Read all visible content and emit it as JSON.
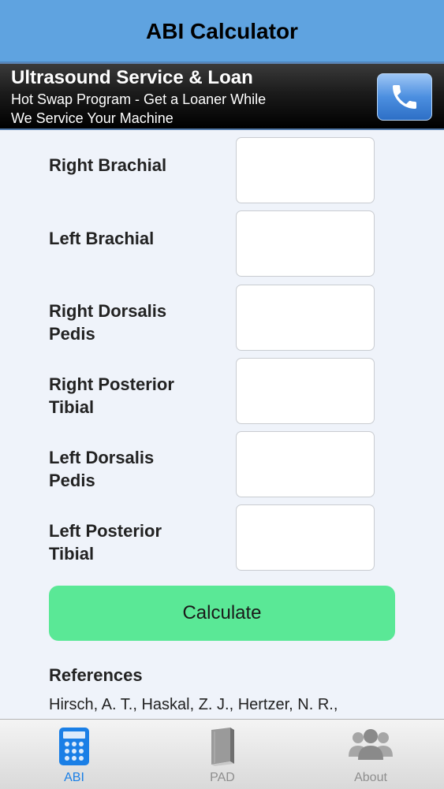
{
  "navbar": {
    "title": "ABI Calculator"
  },
  "ad": {
    "title": "Ultrasound Service & Loan",
    "line1": "Hot Swap Program - Get a Loaner While",
    "line2": "We Service Your Machine"
  },
  "fields": [
    {
      "label_line1": "Right Brachial",
      "label_line2": "",
      "value": ""
    },
    {
      "label_line1": "Left Brachial",
      "label_line2": "",
      "value": ""
    },
    {
      "label_line1": "Right Dorsalis",
      "label_line2": "Pedis",
      "value": ""
    },
    {
      "label_line1": "Right Posterior",
      "label_line2": "Tibial",
      "value": ""
    },
    {
      "label_line1": "Left Dorsalis",
      "label_line2": "Pedis",
      "value": ""
    },
    {
      "label_line1": "Left Posterior",
      "label_line2": "Tibial",
      "value": ""
    }
  ],
  "calculate_label": "Calculate",
  "references": {
    "heading": "References",
    "text": "Hirsch, A. T., Haskal, Z. J., Hertzer, N. R.,"
  },
  "tabs": [
    {
      "label": "ABI",
      "icon": "calculator-icon",
      "active": true
    },
    {
      "label": "PAD",
      "icon": "book-icon",
      "active": false
    },
    {
      "label": "About",
      "icon": "people-icon",
      "active": false
    }
  ],
  "colors": {
    "navbar": "#5fa3e0",
    "calculate_button": "#5ae896",
    "tab_active": "#1a7fe6",
    "tab_inactive": "#8e8e8e",
    "background": "#eff3fa"
  }
}
